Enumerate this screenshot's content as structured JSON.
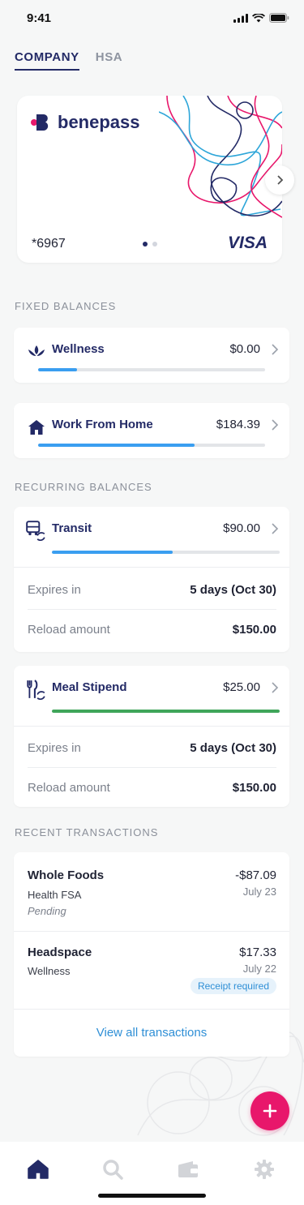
{
  "status_bar": {
    "time": "9:41"
  },
  "tabs": [
    {
      "label": "COMPANY",
      "active": true
    },
    {
      "label": "HSA",
      "active": false
    }
  ],
  "card": {
    "brand": "benepass",
    "number": "*6967",
    "network": "VISA",
    "pages": 2,
    "current_page": 1
  },
  "colors": {
    "navy": "#232a66",
    "pink": "#e8176b",
    "blue_progress": "#3a9ef0",
    "green_progress": "#3fa55a",
    "link_blue": "#2f8fd6"
  },
  "fixed_balances": {
    "title": "FIXED BALANCES",
    "items": [
      {
        "label": "Wellness",
        "amount": "$0.00",
        "icon": "lotus-icon",
        "progress": 0.17
      },
      {
        "label": "Work From Home",
        "amount": "$184.39",
        "icon": "house-icon",
        "progress": 0.69
      }
    ]
  },
  "recurring_balances": {
    "title": "RECURRING BALANCES",
    "items": [
      {
        "label": "Transit",
        "amount": "$90.00",
        "icon": "bus-refresh-icon",
        "progress": 0.53,
        "expires_label": "Expires in",
        "expires_value": "5 days (Oct 30)",
        "reload_label": "Reload amount",
        "reload_value": "$150.00"
      },
      {
        "label": "Meal Stipend",
        "amount": "$25.00",
        "icon": "utensils-refresh-icon",
        "progress": 1.0,
        "expires_label": "Expires in",
        "expires_value": "5 days (Oct 30)",
        "reload_label": "Reload amount",
        "reload_value": "$150.00"
      }
    ]
  },
  "recent_transactions": {
    "title": "RECENT TRANSACTIONS",
    "items": [
      {
        "merchant": "Whole Foods",
        "category": "Health FSA",
        "note": "Pending",
        "amount": "-$87.09",
        "date": "July 23"
      },
      {
        "merchant": "Headspace",
        "category": "Wellness",
        "badge": "Receipt required",
        "amount": "$17.33",
        "date": "July 22"
      }
    ],
    "view_all": "View all transactions"
  },
  "bottom_nav": [
    {
      "name": "home",
      "icon": "home-icon",
      "active": true
    },
    {
      "name": "search",
      "icon": "search-icon",
      "active": false
    },
    {
      "name": "wallet",
      "icon": "wallet-icon",
      "active": false
    },
    {
      "name": "settings",
      "icon": "gear-icon",
      "active": false
    }
  ]
}
